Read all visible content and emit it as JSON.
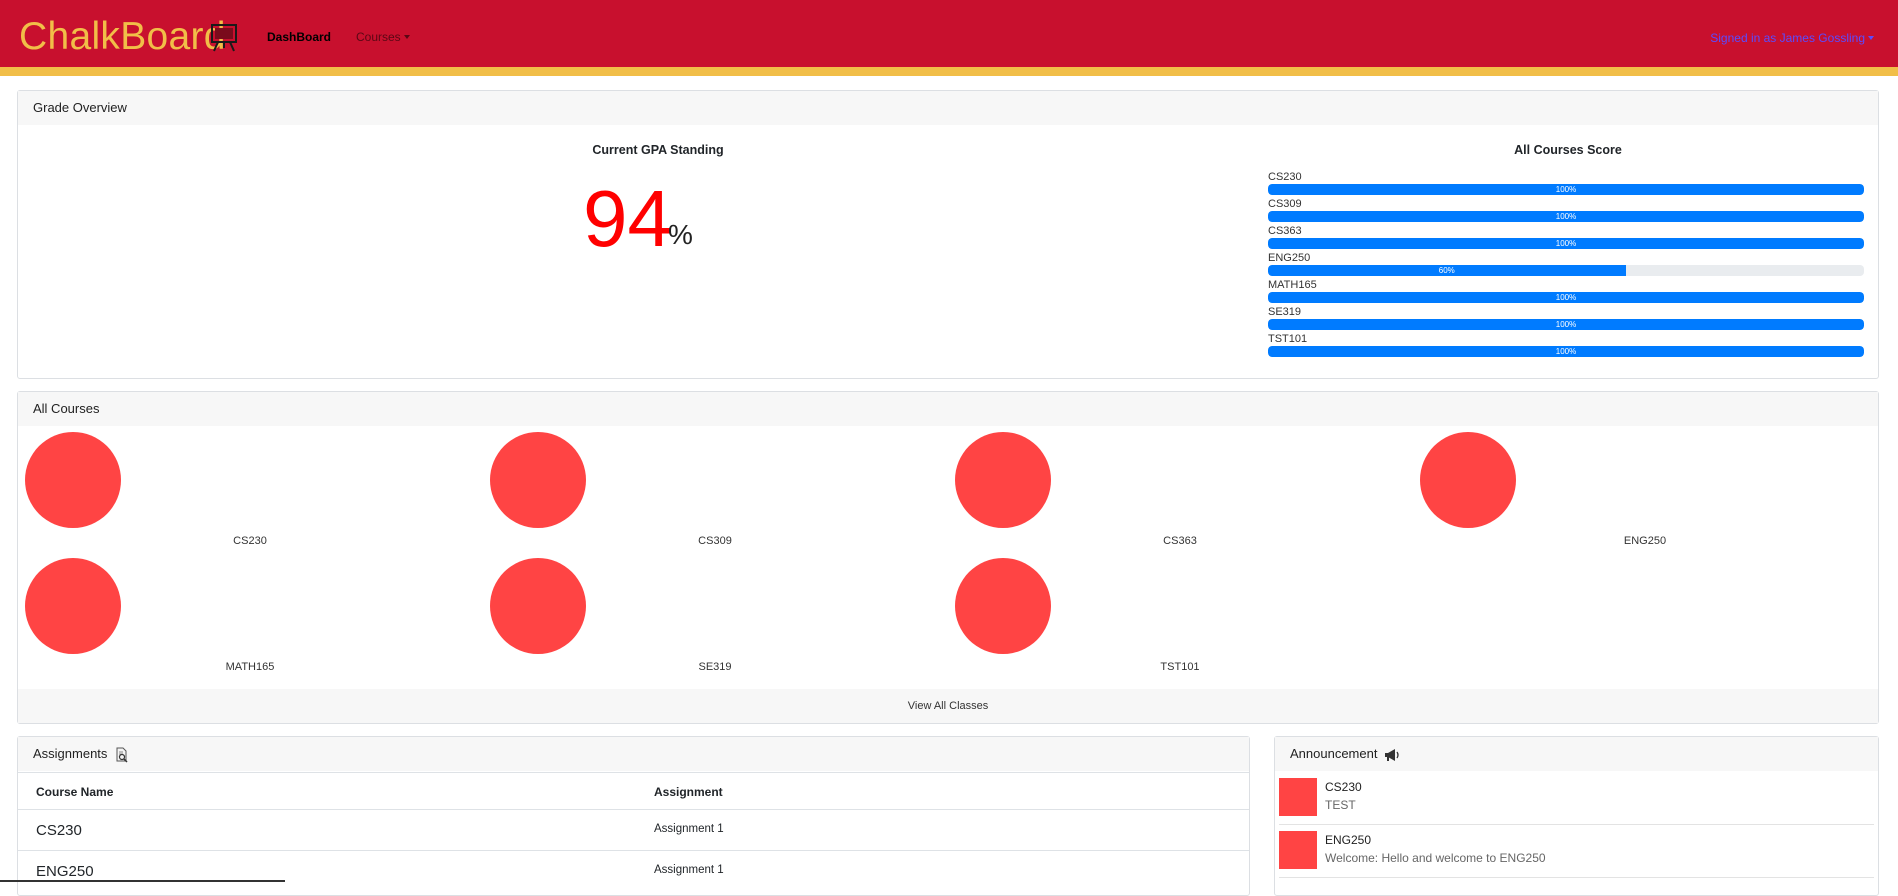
{
  "navbar": {
    "brand": "ChalkBoard",
    "brand_icon": "chalkboard-icon",
    "dashboard_label": "DashBoard",
    "courses_label": "Courses",
    "signed_in_label": "Signed in as James Gossling",
    "colors": {
      "background": "#c8102e",
      "accent": "#f1be48"
    }
  },
  "grade_overview": {
    "header": "Grade Overview",
    "gpa_title": "Current GPA Standing",
    "gpa_value": "94",
    "gpa_unit": "%",
    "scores_title": "All Courses Score",
    "scores": [
      {
        "course": "CS230",
        "percent": 100,
        "label": "100%"
      },
      {
        "course": "CS309",
        "percent": 100,
        "label": "100%"
      },
      {
        "course": "CS363",
        "percent": 100,
        "label": "100%"
      },
      {
        "course": "ENG250",
        "percent": 60,
        "label": "60%"
      },
      {
        "course": "MATH165",
        "percent": 100,
        "label": "100%"
      },
      {
        "course": "SE319",
        "percent": 100,
        "label": "100%"
      },
      {
        "course": "TST101",
        "percent": 100,
        "label": "100%"
      }
    ]
  },
  "all_courses": {
    "header": "All Courses",
    "courses": [
      {
        "name": "CS230"
      },
      {
        "name": "CS309"
      },
      {
        "name": "CS363"
      },
      {
        "name": "ENG250"
      },
      {
        "name": "MATH165"
      },
      {
        "name": "SE319"
      },
      {
        "name": "TST101"
      }
    ],
    "view_all": "View All Classes"
  },
  "assignments": {
    "header": "Assignments",
    "header_icon": "document-search-icon",
    "columns": [
      "Course Name",
      "Assignment"
    ],
    "rows": [
      [
        "CS230",
        "Assignment 1"
      ],
      [
        "ENG250",
        "Assignment 1"
      ]
    ]
  },
  "announcements": {
    "header": "Announcement",
    "header_icon": "megaphone-icon",
    "items": [
      {
        "course": "CS230",
        "text": "TEST"
      },
      {
        "course": "ENG250",
        "text": "Welcome: Hello and welcome to ENG250"
      }
    ]
  }
}
